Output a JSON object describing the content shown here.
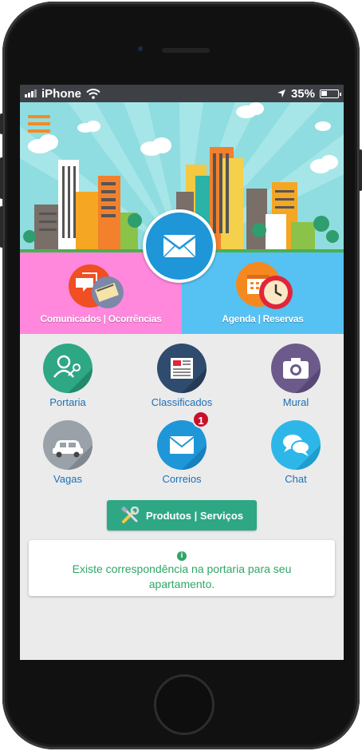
{
  "status_bar": {
    "carrier": "iPhone",
    "battery": "35%"
  },
  "colors": {
    "banner_sky": "#8fdde0",
    "tile_left": "#ff88dd",
    "tile_right": "#56c2f3",
    "accent_green": "#2ea785",
    "label_blue": "#1d6fb8",
    "badge_red": "#c8102e",
    "menu_orange": "#f58a23"
  },
  "tiles": {
    "left_label": "Comunicados | Ocorrências",
    "right_label": "Agenda | Reservas"
  },
  "grid": {
    "portaria": "Portaria",
    "classificados": "Classificados",
    "mural": "Mural",
    "vagas": "Vagas",
    "correios": "Correios",
    "chat": "Chat"
  },
  "correios_badge": "1",
  "products_button": "Produtos | Serviços",
  "notice": {
    "line1": "Existe correspondência na portaria para seu",
    "line2": "apartamento."
  }
}
